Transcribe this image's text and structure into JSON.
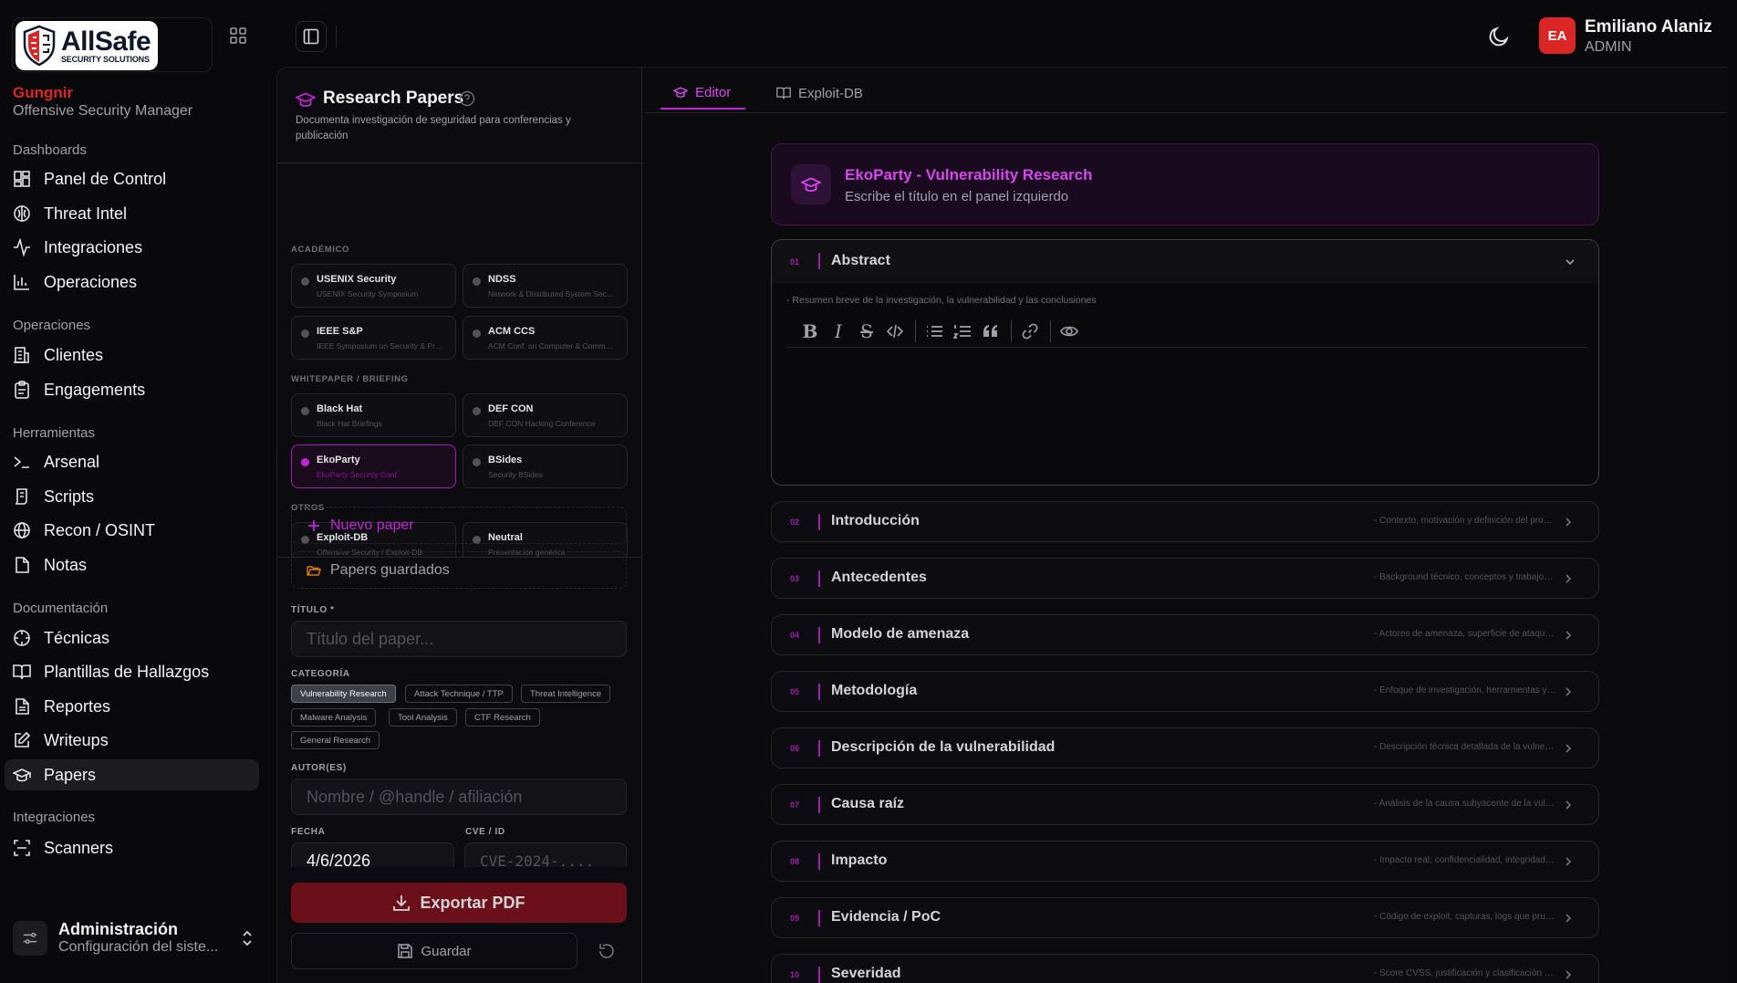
{
  "brand": {
    "logo_name": "AllSafe",
    "logo_sub": "SECURITY SOLUTIONS",
    "org_name": "Gungnir",
    "org_role": "Offensive Security Manager",
    "accent": "#c026d3",
    "brand_red": "#dc2626"
  },
  "sidebar": {
    "sections": [
      {
        "label": "Dashboards",
        "items": [
          {
            "label": "Panel de Control",
            "icon": "dashboard-icon"
          },
          {
            "label": "Threat Intel",
            "icon": "brain-icon"
          },
          {
            "label": "Integraciones",
            "icon": "activity-icon"
          },
          {
            "label": "Operaciones",
            "icon": "bar-chart-icon"
          }
        ]
      },
      {
        "label": "Operaciones",
        "items": [
          {
            "label": "Clientes",
            "icon": "building-icon"
          },
          {
            "label": "Engagements",
            "icon": "clipboard-icon"
          }
        ]
      },
      {
        "label": "Herramientas",
        "items": [
          {
            "label": "Arsenal",
            "icon": "terminal-icon"
          },
          {
            "label": "Scripts",
            "icon": "script-icon"
          },
          {
            "label": "Recon / OSINT",
            "icon": "globe-icon"
          },
          {
            "label": "Notas",
            "icon": "note-icon"
          }
        ]
      },
      {
        "label": "Documentación",
        "items": [
          {
            "label": "Técnicas",
            "icon": "crosshair-icon"
          },
          {
            "label": "Plantillas de Hallazgos",
            "icon": "book-icon"
          },
          {
            "label": "Reportes",
            "icon": "file-text-icon"
          },
          {
            "label": "Writeups",
            "icon": "edit-icon"
          },
          {
            "label": "Papers",
            "icon": "graduation-cap-icon",
            "active": true
          }
        ]
      },
      {
        "label": "Integraciones",
        "items": [
          {
            "label": "Scanners",
            "icon": "scan-icon"
          }
        ]
      }
    ],
    "admin": {
      "title": "Administración",
      "subtitle": "Configuración del siste..."
    }
  },
  "user": {
    "initials": "EA",
    "name": "Emiliano Alaniz",
    "role": "ADMIN"
  },
  "left_panel": {
    "title": "Research Papers",
    "description": "Documenta investigación de seguridad para conferencias y publicación",
    "groups": [
      {
        "label": "ACADÉMICO",
        "templates": [
          {
            "name": "USENIX Security",
            "sub": "USENIX Security Symposium"
          },
          {
            "name": "NDSS",
            "sub": "Network & Distributed System Sec..."
          },
          {
            "name": "IEEE S&P",
            "sub": "IEEE Symposium on Security & Priv..."
          },
          {
            "name": "ACM CCS",
            "sub": "ACM Conf. on Computer & Commu..."
          }
        ]
      },
      {
        "label": "WHITEPAPER / BRIEFING",
        "templates": [
          {
            "name": "Black Hat",
            "sub": "Black Hat Briefings"
          },
          {
            "name": "DEF CON",
            "sub": "DEF CON Hacking Conference"
          },
          {
            "name": "EkoParty",
            "sub": "EkoParty Security Conf.",
            "active": true
          },
          {
            "name": "BSides",
            "sub": "Security BSides"
          }
        ]
      },
      {
        "label": "OTROS",
        "templates": [
          {
            "name": "Exploit-DB",
            "sub": "Offensive Security / Exploit-DB"
          },
          {
            "name": "Neutral",
            "sub": "Presentación genérica"
          }
        ]
      }
    ],
    "new_paper": "Nuevo paper",
    "saved_papers": "Papers guardados",
    "form": {
      "title_label": "TÍTULO *",
      "title_placeholder": "Título del paper...",
      "category_label": "CATEGORÍA",
      "categories": [
        "Vulnerability Research",
        "Attack Technique / TTP",
        "Threat Intelligence",
        "Malware Analysis",
        "Tool Analysis",
        "CTF Research",
        "General Research"
      ],
      "category_selected": "Vulnerability Research",
      "authors_label": "AUTOR(ES)",
      "authors_placeholder": "Nombre / @handle / afiliación",
      "date_label": "FECHA",
      "date_value": "4/6/2026",
      "cve_label": "CVE / ID",
      "cve_placeholder": "CVE-2024-...."
    },
    "export_label": "Exportar PDF",
    "save_label": "Guardar"
  },
  "editor": {
    "tabs": [
      "Editor",
      "Exploit-DB"
    ],
    "active_tab": "Editor",
    "banner_title": "EkoParty - Vulnerability Research",
    "banner_sub": "Escribe el título en el panel izquierdo",
    "sections": [
      {
        "num": "01",
        "title": "Abstract",
        "hint": "- Resumen breve de la investigación, la vulnerabilidad y las conclusiones",
        "open": true
      },
      {
        "num": "02",
        "title": "Introducción",
        "hint": "- Contexto, motivación y definición del problema"
      },
      {
        "num": "03",
        "title": "Antecedentes",
        "hint": "- Background técnico, conceptos y trabajos relacionados"
      },
      {
        "num": "04",
        "title": "Modelo de amenaza",
        "hint": "- Actores de amenaza, superficie de ataque y supuestos"
      },
      {
        "num": "05",
        "title": "Metodología",
        "hint": "- Enfoque de investigación, herramientas y técnicas"
      },
      {
        "num": "06",
        "title": "Descripción de la vulnerabilidad",
        "hint": "- Descripción técnica detallada de la vulnerabilidad"
      },
      {
        "num": "07",
        "title": "Causa raíz",
        "hint": "- Análisis de la causa subyacente de la vulnerabilidad"
      },
      {
        "num": "08",
        "title": "Impacto",
        "hint": "- Impacto real: confidencialidad, integridad, disponibilidad"
      },
      {
        "num": "09",
        "title": "Evidencia / PoC",
        "hint": "- Código de exploit, capturas, logs que prueban el hallazgo"
      },
      {
        "num": "10",
        "title": "Severidad",
        "hint": "- Score CVSS, justificación y clasificación de riesgo"
      }
    ]
  }
}
